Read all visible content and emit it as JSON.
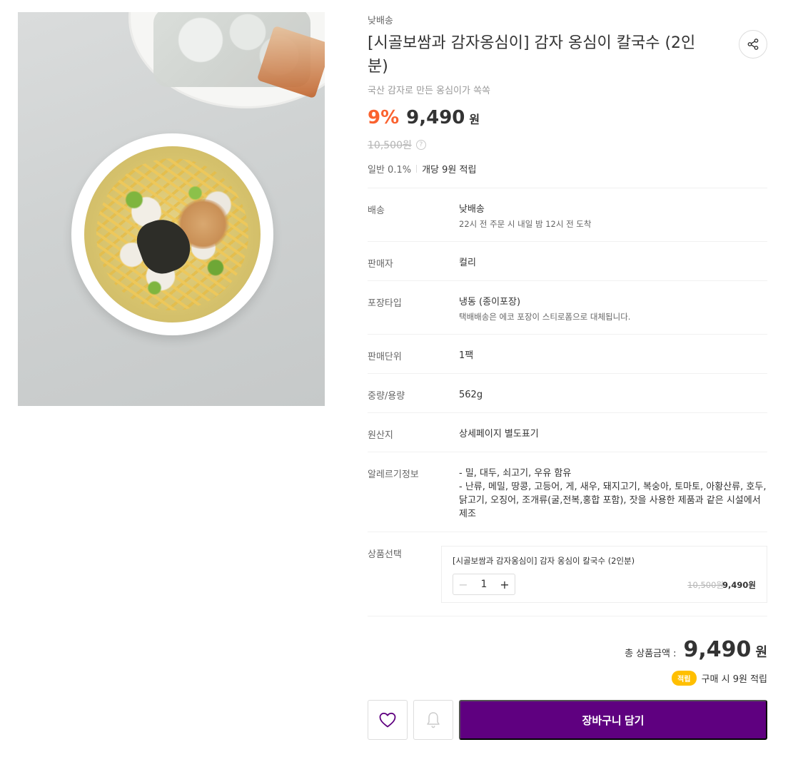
{
  "image": {
    "alt": "감자 옹심이 칼국수"
  },
  "product": {
    "delivery_type": "낮배송",
    "title": "[시골보쌈과 감자옹심이] 감자 옹심이 칼국수 (2인분)",
    "subtitle": "국산 감자로 만든 옹심이가 쏙쏙",
    "discount": "9%",
    "price": "9,490",
    "price_unit": "원",
    "original_price": "10,500원",
    "info_glyph": "?",
    "point_grade": "일반 0.1%",
    "point_detail": "개당 9원 적립"
  },
  "info_rows": [
    {
      "label": "배송",
      "value": "낮배송",
      "sub": "22시 전 주문 시 내일 밤 12시 전 도착"
    },
    {
      "label": "판매자",
      "value": "컬리",
      "sub": ""
    },
    {
      "label": "포장타입",
      "value": "냉동 (종이포장)",
      "sub": "택배배송은 에코 포장이 스티로폼으로 대체됩니다."
    },
    {
      "label": "판매단위",
      "value": "1팩",
      "sub": ""
    },
    {
      "label": "중량/용량",
      "value": "562g",
      "sub": ""
    },
    {
      "label": "원산지",
      "value": "상세페이지 별도표기",
      "sub": ""
    },
    {
      "label": "알레르기정보",
      "value": "- 밀, 대두, 쇠고기, 우유 함유",
      "value2": "- 난류, 메밀, 땅콩, 고등어, 게, 새우, 돼지고기, 복숭아, 토마토, 아황산류, 호두, 닭고기, 오징어, 조개류(굴,전복,홍합 포함), 잣을 사용한 제품과 같은 시설에서 제조"
    }
  ],
  "option": {
    "label": "상품선택",
    "name": "[시골보쌈과 감자옹심이] 감자 옹심이 칼국수 (2인분)",
    "minus": "−",
    "qty": "1",
    "plus": "+",
    "original_price": "10,500원",
    "price": "9,490원"
  },
  "total": {
    "label": "총 상품금액 :",
    "price": "9,490",
    "unit": "원",
    "badge": "적립",
    "reward": "구매 시 9원 적립"
  },
  "actions": {
    "cart_label": "장바구니 담기",
    "wish_icon": "heart-icon",
    "notify_icon": "bell-icon"
  },
  "colors": {
    "accent": "#5f0080",
    "discount": "#fa622f",
    "badge": "#ffbf00"
  }
}
